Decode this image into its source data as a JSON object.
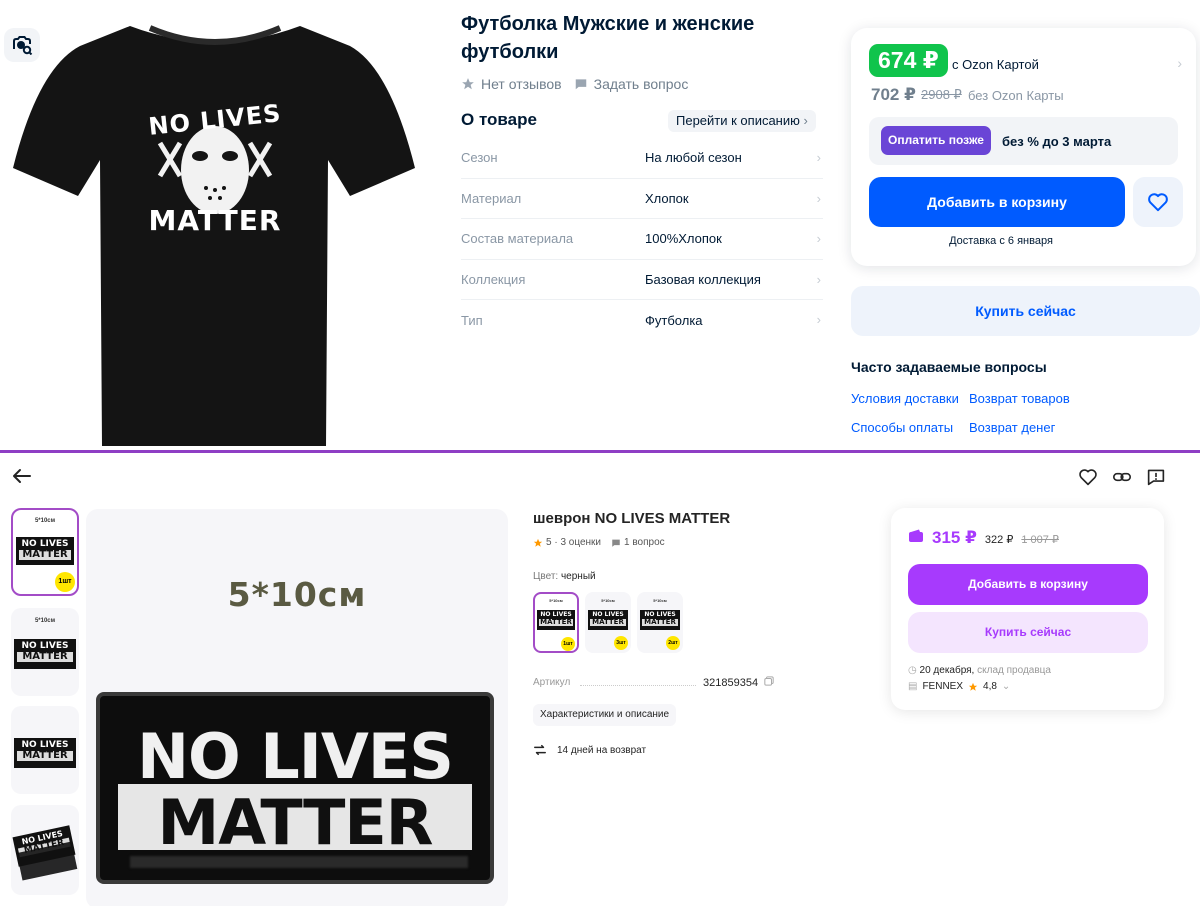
{
  "ozon": {
    "title": "Футболка Мужские и женские футболки",
    "tshirt_print": {
      "line1": "NO LIVES",
      "line2": "MATTER"
    },
    "reviews": "Нет отзывов",
    "ask": "Задать вопрос",
    "about_title": "О товаре",
    "goto_description": "Перейти к описанию",
    "specs": [
      {
        "key": "Сезон",
        "value": "На любой сезон"
      },
      {
        "key": "Материал",
        "value": "Хлопок"
      },
      {
        "key": "Состав материала",
        "value": "100%Хлопок"
      },
      {
        "key": "Коллекция",
        "value": "Базовая коллекция"
      },
      {
        "key": "Тип",
        "value": "Футболка"
      }
    ],
    "price_card": {
      "card_price": "674 ₽",
      "card_price_note": "с Ozon Картой",
      "price": "702 ₽",
      "old_price": "2908 ₽",
      "price_note": "без Ozon Карты",
      "pay_later": "Оплатить позже",
      "pay_later_note": "без % до 3 марта",
      "add_to_cart": "Добавить в корзину",
      "delivery": "Доставка с 6 января"
    },
    "buy_now": "Купить сейчас",
    "faq_title": "Часто задаваемые вопросы",
    "faq_links": [
      "Условия доставки",
      "Возврат товаров",
      "Способы оплаты",
      "Возврат денег"
    ],
    "accent": "#005bff",
    "price_green": "#10c44c"
  },
  "wb": {
    "title": "шеврон NO LIVES MATTER",
    "rating": "5 · 3 оценки",
    "questions": "1 вопрос",
    "color_label": "Цвет:",
    "color_value": "черный",
    "main_image": {
      "size_text": "5*10см",
      "patch_line1": "NO LIVES",
      "patch_line2": "MATTER"
    },
    "thumbs": [
      {
        "size": "5*10см",
        "l1": "NO LIVES",
        "l2": "MATTER",
        "badge": "1шт"
      },
      {
        "size": "5*10см",
        "l1": "NO LIVES",
        "l2": "MATTER"
      },
      {
        "l1": "NO LIVES",
        "l2": "MATTER"
      },
      {
        "l1": "NO LIVES",
        "l2": "MATTER"
      }
    ],
    "variants": [
      {
        "size": "5*10см",
        "l1": "NO LIVES",
        "l2": "MATTER",
        "badge": "1шт"
      },
      {
        "size": "5*10см",
        "l1": "NO LIVES",
        "l2": "MATTER",
        "badge": "3шт"
      },
      {
        "size": "5*10см",
        "l1": "NO LIVES",
        "l2": "MATTER",
        "badge": "2шт"
      }
    ],
    "article_label": "Артикул",
    "article_value": "321859354",
    "chars_button": "Характеристики и описание",
    "return_text": "14 дней на возврат",
    "card": {
      "price": "315 ₽",
      "price_regular": "322 ₽",
      "price_old": "1 007 ₽",
      "add_to_cart": "Добавить в корзину",
      "buy_now": "Купить сейчас",
      "delivery_date": "20 декабря,",
      "delivery_from": "склад продавца",
      "seller": "FENNEX",
      "seller_rating": "4,8"
    },
    "accent": "#a73afd"
  }
}
